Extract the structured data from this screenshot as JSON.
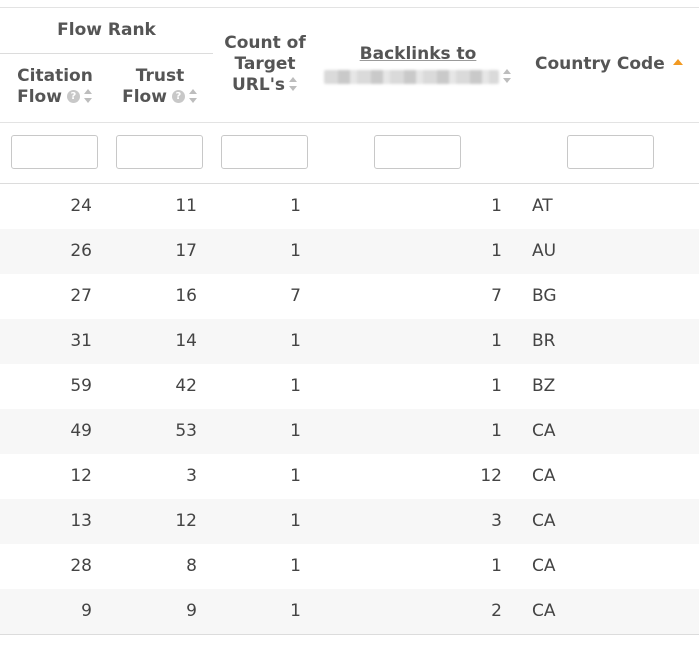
{
  "headers": {
    "flow_rank": "Flow Rank",
    "citation_flow": [
      "Citation",
      "Flow"
    ],
    "trust_flow": [
      "Trust",
      "Flow"
    ],
    "count_target": [
      "Count of",
      "Target",
      "URL's"
    ],
    "backlinks_to": "Backlinks to",
    "country_code": "Country Code"
  },
  "help_glyph": "?",
  "rows": [
    {
      "citation_flow": "24",
      "trust_flow": "11",
      "count": "1",
      "backlinks": "1",
      "country": "AT"
    },
    {
      "citation_flow": "26",
      "trust_flow": "17",
      "count": "1",
      "backlinks": "1",
      "country": "AU"
    },
    {
      "citation_flow": "27",
      "trust_flow": "16",
      "count": "7",
      "backlinks": "7",
      "country": "BG"
    },
    {
      "citation_flow": "31",
      "trust_flow": "14",
      "count": "1",
      "backlinks": "1",
      "country": "BR"
    },
    {
      "citation_flow": "59",
      "trust_flow": "42",
      "count": "1",
      "backlinks": "1",
      "country": "BZ"
    },
    {
      "citation_flow": "49",
      "trust_flow": "53",
      "count": "1",
      "backlinks": "1",
      "country": "CA"
    },
    {
      "citation_flow": "12",
      "trust_flow": "3",
      "count": "1",
      "backlinks": "12",
      "country": "CA"
    },
    {
      "citation_flow": "13",
      "trust_flow": "12",
      "count": "1",
      "backlinks": "3",
      "country": "CA"
    },
    {
      "citation_flow": "28",
      "trust_flow": "8",
      "count": "1",
      "backlinks": "1",
      "country": "CA"
    },
    {
      "citation_flow": "9",
      "trust_flow": "9",
      "count": "1",
      "backlinks": "2",
      "country": "CA"
    }
  ],
  "colors": {
    "sort_active": "#f29a22",
    "row_alt": "#f7f7f7"
  }
}
